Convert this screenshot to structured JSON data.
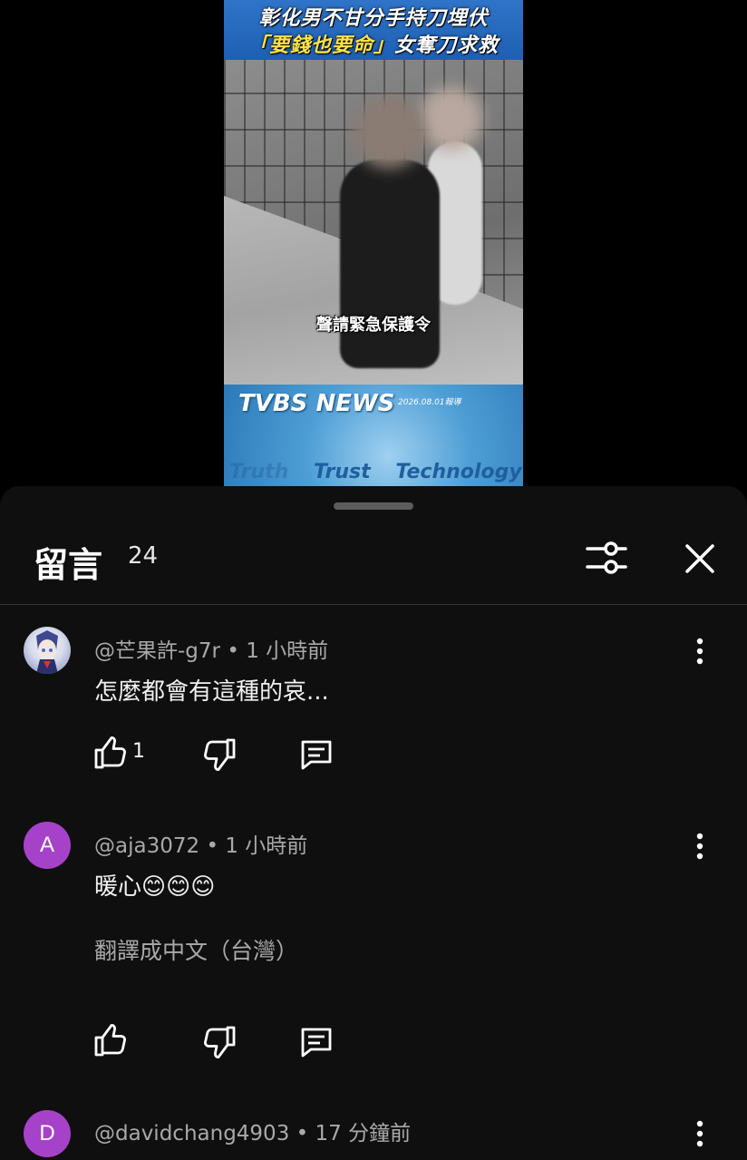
{
  "video": {
    "headline_line1": "彰化男不甘分手持刀埋伏",
    "headline_line2_highlight": "「要錢也要命」",
    "headline_line2_rest": "女奪刀求救",
    "caption": "聲請緊急保護令",
    "logo_text": "TVBS NEWS",
    "logo_date": "2026.08.01報導",
    "tagline": [
      "Truth",
      "Trust",
      "Technology"
    ]
  },
  "comments_panel": {
    "title": "留言",
    "count": "24",
    "filter_icon": "sliders-icon",
    "close_icon": "close-icon"
  },
  "comments": [
    {
      "avatar_type": "image",
      "avatar_letter": "",
      "author": "@芒果許-g7r",
      "separator": "•",
      "time": "1 小時前",
      "text": "怎麼都會有這種的哀...",
      "likes": "1",
      "translate": ""
    },
    {
      "avatar_type": "letter",
      "avatar_letter": "A",
      "avatar_color": "#a642c9",
      "author": "@aja3072",
      "separator": "•",
      "time": "1 小時前",
      "text": "暖心😊😊😊",
      "likes": "",
      "translate": "翻譯成中文（台灣）"
    },
    {
      "avatar_type": "letter",
      "avatar_letter": "D",
      "avatar_color": "#a642c9",
      "author": "@davidchang4903",
      "separator": "•",
      "time": "17 分鐘前",
      "text": "",
      "likes": "",
      "translate": ""
    }
  ],
  "colors": {
    "sheet_bg": "#0f0f0f",
    "avatar_purple": "#a642c9",
    "meta_gray": "#a9a9a9"
  }
}
